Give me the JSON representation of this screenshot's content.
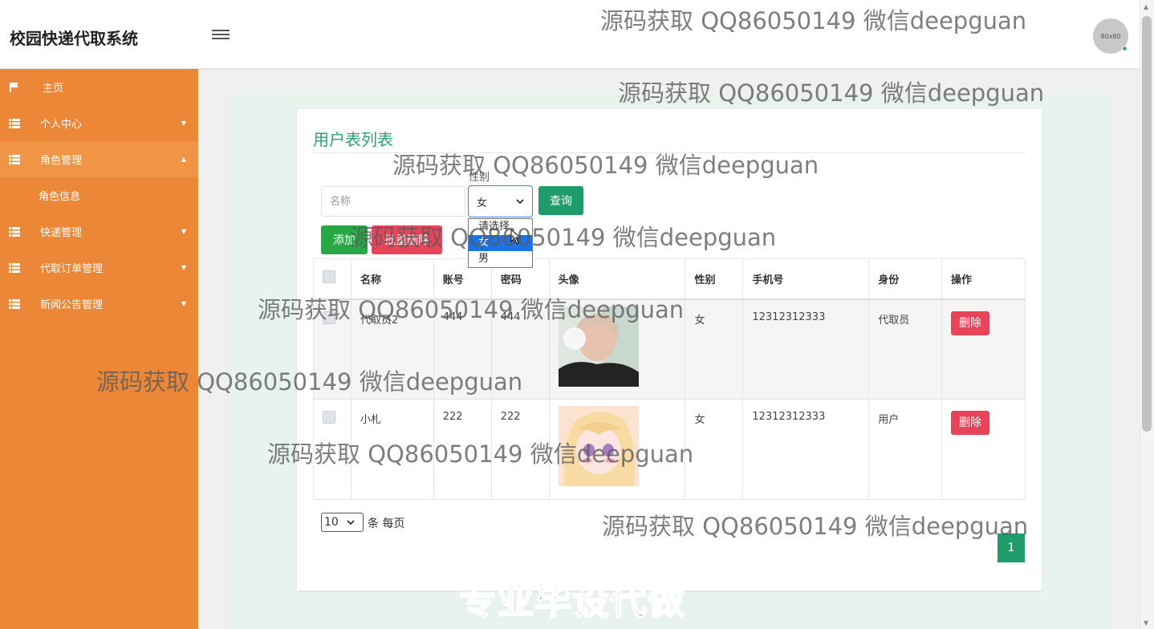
{
  "header": {
    "title": "校园快递代取系统",
    "avatar_text": "80x80"
  },
  "sidebar": {
    "items": [
      {
        "label": "主页",
        "icon": "flag-icon",
        "caret": ""
      },
      {
        "label": "个人中心",
        "icon": "grid-icon",
        "caret": "▼"
      },
      {
        "label": "角色管理",
        "icon": "grid-icon",
        "caret": "▲"
      },
      {
        "label": "快递管理",
        "icon": "grid-icon",
        "caret": "▼"
      },
      {
        "label": "代取订单管理",
        "icon": "grid-icon",
        "caret": "▼"
      },
      {
        "label": "新闻公告管理",
        "icon": "grid-icon",
        "caret": "▼"
      }
    ],
    "sub_item": "角色信息"
  },
  "main": {
    "title": "用户表列表",
    "search_placeholder": "名称",
    "gender_label": "性别",
    "gender_selected": "女",
    "gender_options": [
      "请选择",
      "女",
      "男"
    ],
    "query_button": "查询",
    "add_button": "添加",
    "batch_delete_button": "批量删除"
  },
  "table": {
    "columns": [
      "名称",
      "账号",
      "密码",
      "头像",
      "性别",
      "手机号",
      "身份",
      "操作"
    ],
    "rows": [
      {
        "name": "代取员2",
        "account": "444",
        "password": "444",
        "gender": "女",
        "phone": "12312312333",
        "role": "代取员",
        "action": "删除"
      },
      {
        "name": "小札",
        "account": "222",
        "password": "222",
        "gender": "女",
        "phone": "12312312333",
        "role": "用户",
        "action": "删除"
      }
    ]
  },
  "pagination": {
    "page_size": "10",
    "page_size_label": "条 每页",
    "current_page": "1"
  },
  "watermarks": {
    "text": "源码获取 QQ86050149 微信deepguan",
    "bottom": "专业毕设代做"
  },
  "colors": {
    "sidebar": "#ec8737",
    "accent_green": "#1f9c6b",
    "danger": "#e9435a",
    "title_green": "#2aa36b"
  }
}
